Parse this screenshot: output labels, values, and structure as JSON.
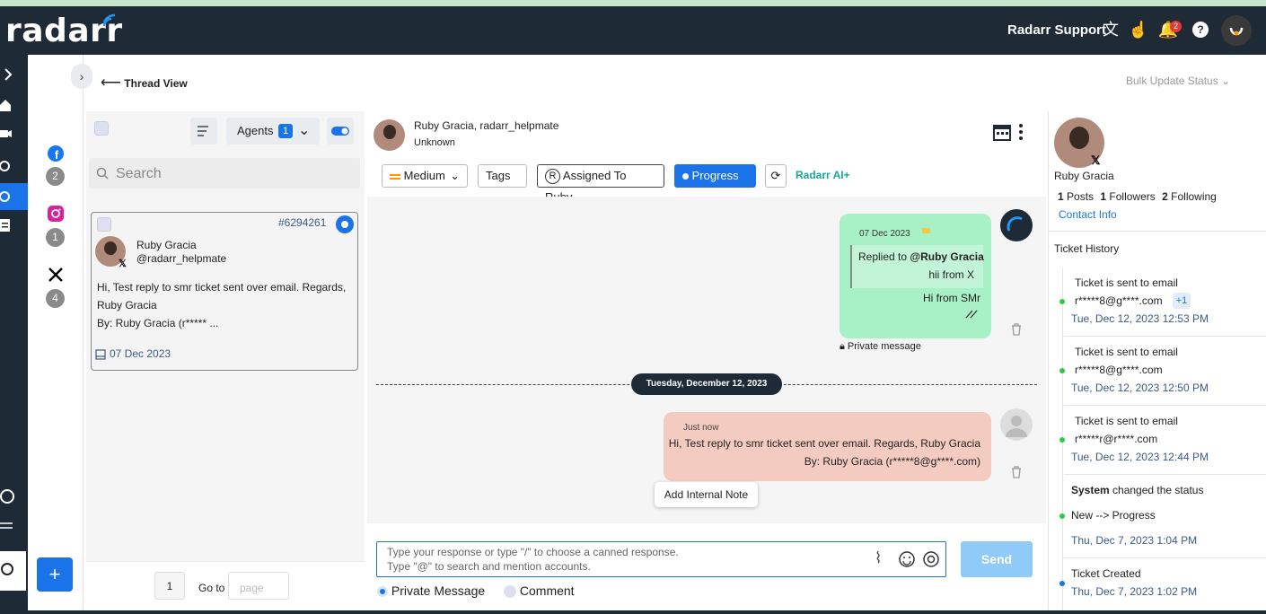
{
  "app": {
    "logo": "radarr",
    "user_name": "Radarr Support",
    "notification_count": "2"
  },
  "channels": [
    {
      "icon": "facebook-icon",
      "count": "2"
    },
    {
      "icon": "instagram-icon",
      "count": "1"
    },
    {
      "icon": "x-icon",
      "count": "4"
    }
  ],
  "header": {
    "back_label": "Thread View",
    "bulk_label": "Bulk Update Status"
  },
  "list": {
    "agents_label": "Agents",
    "agents_count": "1",
    "search_placeholder": "Search",
    "card": {
      "ticket_id": "#6294261",
      "name": "Ruby Gracia",
      "handle": "@radarr_helpmate",
      "body_line1": "Hi, Test reply to smr ticket sent over email. Regards,",
      "body_line2": "Ruby Gracia",
      "body_line3": "By: Ruby Gracia (r***** ...",
      "date": "07 Dec 2023"
    },
    "pager": {
      "page": "1",
      "goto_label": "Go to",
      "page_placeholder": "page"
    }
  },
  "thread": {
    "participants": "Ruby Gracia, radarr_helpmate",
    "status_sub": "Unknown",
    "priority": "Medium",
    "tags": "Tags",
    "assigned": "Assigned To Ruby",
    "assigned_initial": "R",
    "progress": "Progress",
    "ai_label": "Radarr AI+",
    "msg1": {
      "date": "07 Dec 2023",
      "replied_prefix": "Replied to ",
      "replied_to": "@Ruby Gracia",
      "quoted": "hii from X",
      "text": "Hi from SMr",
      "private_label": "Private message"
    },
    "day_divider": "Tuesday, December 12, 2023",
    "msg2": {
      "time": "Just now",
      "line1": "Hi, Test reply to smr ticket sent over email. Regards, Ruby Gracia",
      "line2": "By: Ruby Gracia (r*****8@g****.com)"
    },
    "internal_note": "Add Internal Note",
    "composer_ph1": "Type your response or type \"/\" to choose a canned response.",
    "composer_ph2": "Type \"@\" to search and mention accounts.",
    "send": "Send",
    "opt_private": "Private Message",
    "opt_comment": "Comment"
  },
  "profile": {
    "name": "Ruby Gracia",
    "posts": "1",
    "posts_label": "Posts",
    "followers": "1",
    "followers_label": "Followers",
    "following": "2",
    "following_label": "Following",
    "contact_info": "Contact Info",
    "history_title": "Ticket History",
    "history": [
      {
        "line1": "Ticket is sent to email",
        "line2": "r*****8@g****.com",
        "extra": "+1",
        "date": "Tue, Dec 12, 2023 12:53 PM"
      },
      {
        "line1": "Ticket is sent to email",
        "line2": "r*****8@g****.com",
        "date": "Tue, Dec 12, 2023 12:50 PM"
      },
      {
        "line1": "Ticket is sent to email",
        "line2": "r*****r@r****.com",
        "date": "Tue, Dec 12, 2023 12:44 PM"
      },
      {
        "actor": "System",
        "action": " changed the status",
        "line2": "New --> Progress",
        "date": "Thu, Dec 7, 2023 1:04 PM"
      },
      {
        "line1": "Ticket Created",
        "date": "Thu, Dec 7, 2023 1:02 PM"
      }
    ]
  },
  "colors": {
    "topbar": "#1f2a37",
    "accent": "#1a73e8",
    "green_bubble": "#a8f0c6",
    "red_bubble": "#f4cbc0"
  }
}
